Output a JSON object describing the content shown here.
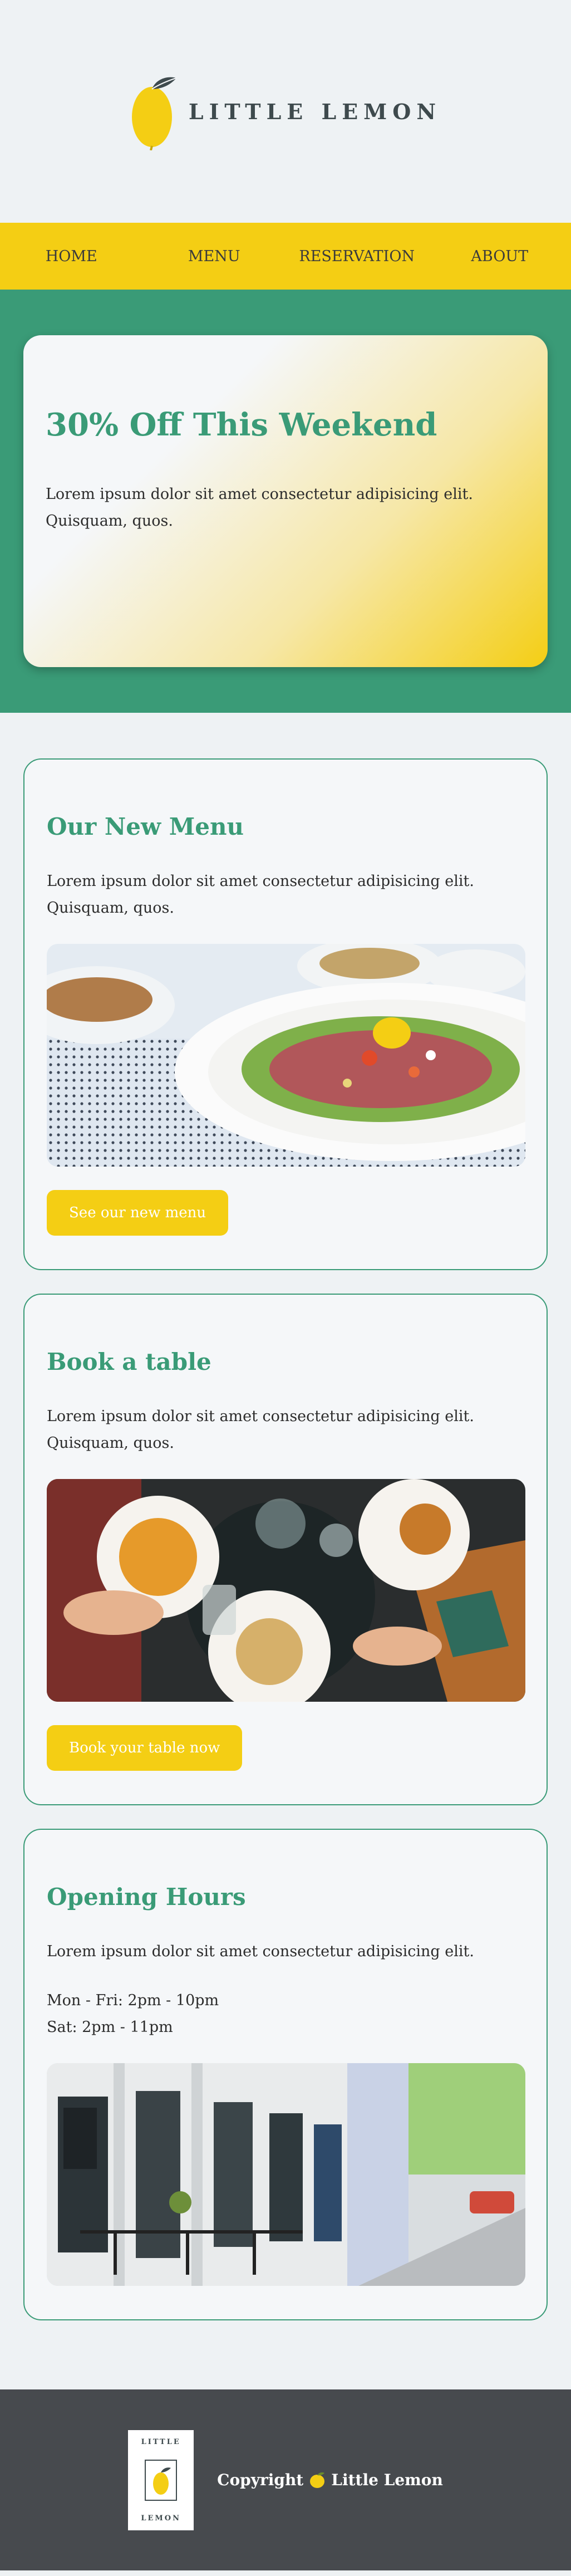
{
  "brand": {
    "name": "LITTLE LEMON",
    "footer_line1": "LITTLE",
    "footer_line2": "LEMON"
  },
  "nav": {
    "items": [
      "HOME",
      "MENU",
      "RESERVATION",
      "ABOUT"
    ]
  },
  "hero": {
    "title": "30% Off This Weekend",
    "text": "Lorem ipsum dolor sit amet consectetur adipisicing elit. Quisquam, quos."
  },
  "menu_card": {
    "title": "Our New Menu",
    "text": "Lorem ipsum dolor sit amet consectetur adipisicing elit. Quisquam, quos.",
    "button": "See our new menu"
  },
  "book_card": {
    "title": "Book a table",
    "text": "Lorem ipsum dolor sit amet consectetur adipisicing elit. Quisquam, quos.",
    "button": "Book your table now"
  },
  "hours_card": {
    "title": "Opening Hours",
    "text": "Lorem ipsum dolor sit amet consectetur adipisicing elit.",
    "weekday": "Mon - Fri: 2pm - 10pm",
    "saturday": "Sat: 2pm - 11pm"
  },
  "footer": {
    "copyright": "Copyright",
    "brand": "Little Lemon"
  },
  "colors": {
    "green": "#3a9b77",
    "yellow": "#f4ce14",
    "dark": "#474a4e",
    "background": "#eef2f4"
  },
  "icons": {
    "logo": "lemon-icon",
    "footer_lemon": "lemon-icon"
  }
}
